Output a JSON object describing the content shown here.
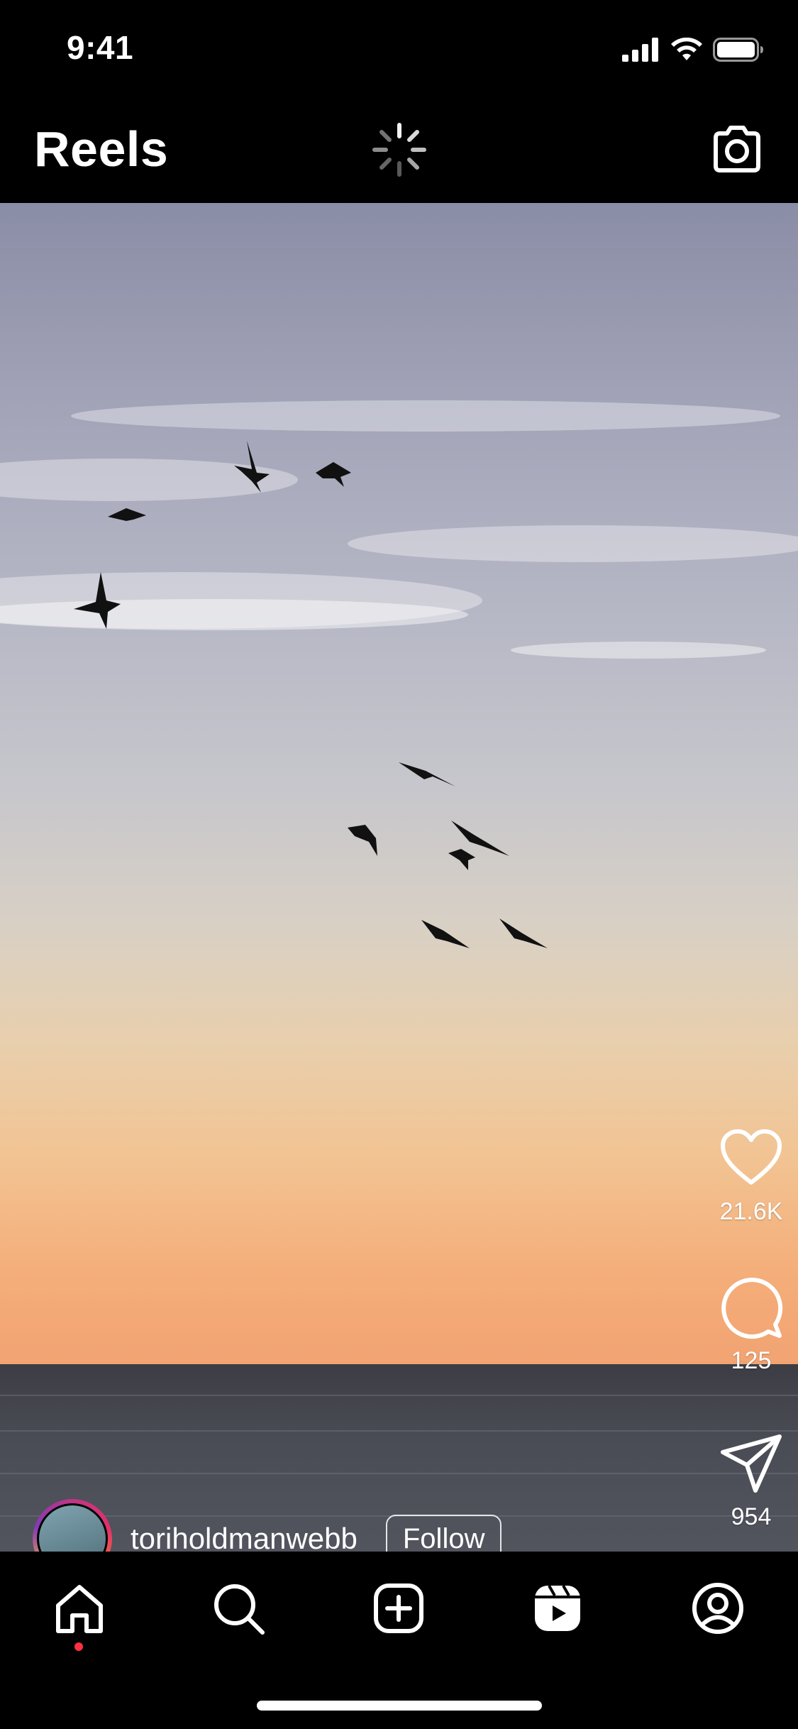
{
  "status_bar": {
    "time": "9:41"
  },
  "header": {
    "title": "Reels"
  },
  "reel": {
    "likes": "21.6K",
    "comments": "125",
    "shares": "954",
    "author": {
      "username": "toriholdmanwebb",
      "follow_label": "Follow"
    }
  },
  "tab_bar": {
    "items": [
      "home-icon",
      "search-icon",
      "create-icon",
      "reels-icon",
      "profile-icon"
    ],
    "active": "home-icon",
    "indicator_color": "#ff3040"
  },
  "colors": {
    "background": "#000000",
    "sky_top": "#8a8da6",
    "sky_horizon": "#f2a372",
    "sea": "#4a4c55",
    "avatar_ring": "#e1306c"
  }
}
